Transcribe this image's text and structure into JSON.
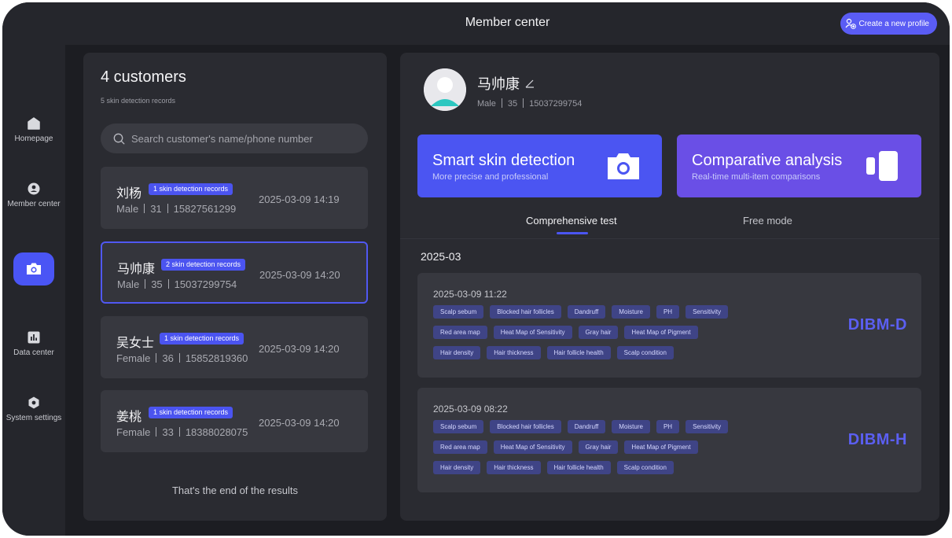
{
  "header": {
    "title": "Member center",
    "create_button": "Create a new profile"
  },
  "sidebar": {
    "items": [
      {
        "label": "Homepage",
        "icon": "home-icon"
      },
      {
        "label": "Member center",
        "icon": "member-icon"
      },
      {
        "label": "",
        "icon": "camera-icon"
      },
      {
        "label": "Data center",
        "icon": "chart-icon"
      },
      {
        "label": "System settings",
        "icon": "settings-icon"
      }
    ]
  },
  "customers": {
    "title": "4 customers",
    "subtitle": "5 skin detection records",
    "search_placeholder": "Search customer's name/phone number",
    "list": [
      {
        "name": "刘杨",
        "badge": "1 skin detection records",
        "gender": "Male",
        "age": "31",
        "phone": "15827561299",
        "time": "2025-03-09 14:19"
      },
      {
        "name": "马帅康",
        "badge": "2 skin detection records",
        "gender": "Male",
        "age": "35",
        "phone": "15037299754",
        "time": "2025-03-09 14:20"
      },
      {
        "name": "吴女士",
        "badge": "1 skin detection records",
        "gender": "Female",
        "age": "36",
        "phone": "15852819360",
        "time": "2025-03-09 14:20"
      },
      {
        "name": "姜桃",
        "badge": "1 skin detection records",
        "gender": "Female",
        "age": "33",
        "phone": "18388028075",
        "time": "2025-03-09 14:20"
      }
    ],
    "end_text": "That's the end of the results"
  },
  "profile": {
    "name": "马帅康",
    "gender": "Male",
    "age": "35",
    "phone": "15037299754"
  },
  "features": {
    "smart": {
      "title": "Smart skin detection",
      "subtitle": "More precise and professional"
    },
    "compare": {
      "title": "Comparative analysis",
      "subtitle": "Real-time multi-item comparisons"
    }
  },
  "tabs": {
    "active": "Comprehensive test",
    "inactive": "Free mode"
  },
  "records": {
    "month": "2025-03",
    "items": [
      {
        "time": "2025-03-09   11:22",
        "device": "DIBM-D",
        "rows": [
          [
            "Scalp sebum",
            "Blocked hair follicles",
            "Dandruff",
            "Moisture",
            "PH",
            "Sensitivity"
          ],
          [
            "Red area map",
            "Heat Map of Sensitivity",
            "Gray hair",
            "Heat Map of Pigment"
          ],
          [
            "Hair density",
            "Hair thickness",
            "Hair follicle health",
            "Scalp condition"
          ]
        ]
      },
      {
        "time": "2025-03-09   08:22",
        "device": "DIBM-H",
        "rows": [
          [
            "Scalp sebum",
            "Blocked hair follicles",
            "Dandruff",
            "Moisture",
            "PH",
            "Sensitivity"
          ],
          [
            "Red area map",
            "Heat Map of Sensitivity",
            "Gray hair",
            "Heat Map of Pigment"
          ],
          [
            "Hair density",
            "Hair thickness",
            "Hair follicle health",
            "Scalp condition"
          ]
        ]
      }
    ]
  },
  "colors": {
    "accent": "#4b55f2",
    "accent_purple": "#6a4fe6",
    "chip_bg": "#3f4486",
    "device_code": "#5b5ff2"
  }
}
